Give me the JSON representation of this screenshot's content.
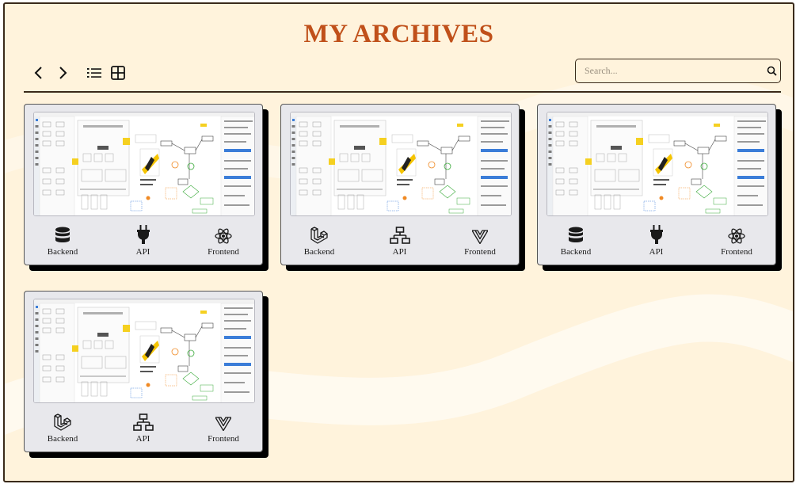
{
  "header": {
    "title": "MY ARCHIVES"
  },
  "toolbar": {
    "search_placeholder": "Search..."
  },
  "colors": {
    "accent": "#c0501a",
    "background": "#fff3dc",
    "card": "#e8e8ec",
    "border": "#3a2a1a"
  },
  "archives": [
    {
      "tags": [
        {
          "label": "Backend",
          "icon": "database-icon"
        },
        {
          "label": "API",
          "icon": "plug-icon"
        },
        {
          "label": "Frontend",
          "icon": "react-icon"
        }
      ]
    },
    {
      "tags": [
        {
          "label": "Backend",
          "icon": "laravel-icon"
        },
        {
          "label": "API",
          "icon": "network-icon"
        },
        {
          "label": "Frontend",
          "icon": "vue-icon"
        }
      ]
    },
    {
      "tags": [
        {
          "label": "Backend",
          "icon": "database-icon"
        },
        {
          "label": "API",
          "icon": "plug-icon"
        },
        {
          "label": "Frontend",
          "icon": "react-icon"
        }
      ]
    },
    {
      "tags": [
        {
          "label": "Backend",
          "icon": "laravel-icon"
        },
        {
          "label": "API",
          "icon": "network-icon"
        },
        {
          "label": "Frontend",
          "icon": "vue-icon"
        }
      ]
    }
  ]
}
